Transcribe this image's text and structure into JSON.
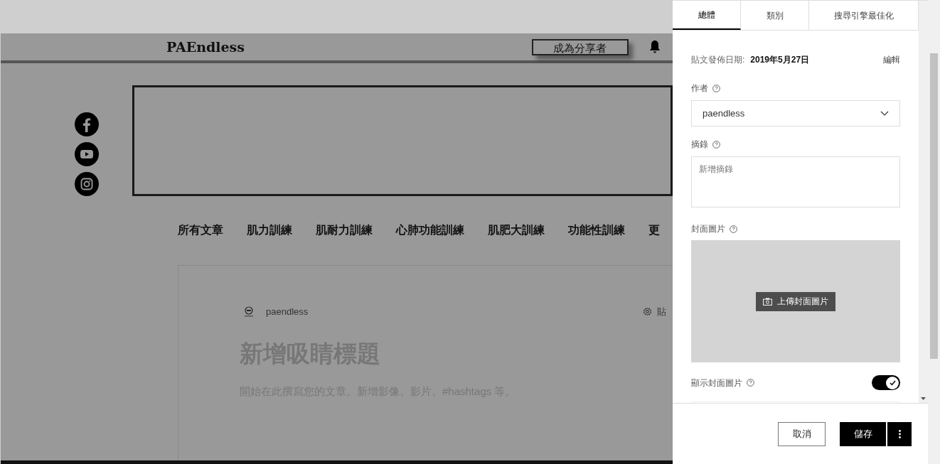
{
  "site": {
    "logo": "PAEndless",
    "share_button": "成為分享者"
  },
  "nav": [
    "所有文章",
    "肌力訓練",
    "肌耐力訓練",
    "心肺功能訓練",
    "肌肥大訓練",
    "功能性訓練",
    "更"
  ],
  "post": {
    "author": "paendless",
    "settings": "貼",
    "title_placeholder": "新增吸睛標題",
    "body_placeholder": "開始在此撰寫您的文章。新增影像、影片、#hashtags 等。"
  },
  "panel": {
    "tabs": [
      {
        "label": "總體",
        "selected": true
      },
      {
        "label": "類別",
        "selected": false
      },
      {
        "label": "搜尋引擎最佳化",
        "selected": false
      }
    ],
    "date_label": "貼文發佈日期:",
    "date_value": "2019年5月27日",
    "edit_link": "編輯",
    "author_label": "作者",
    "author_value": "paendless",
    "excerpt_label": "摘錄",
    "excerpt_placeholder": "新增摘錄",
    "cover_label": "封面圖片",
    "upload_button": "上傳封面圖片",
    "show_cover_label": "顯示封面圖片",
    "show_cover_on": true,
    "cancel": "取消",
    "save": "儲存"
  }
}
